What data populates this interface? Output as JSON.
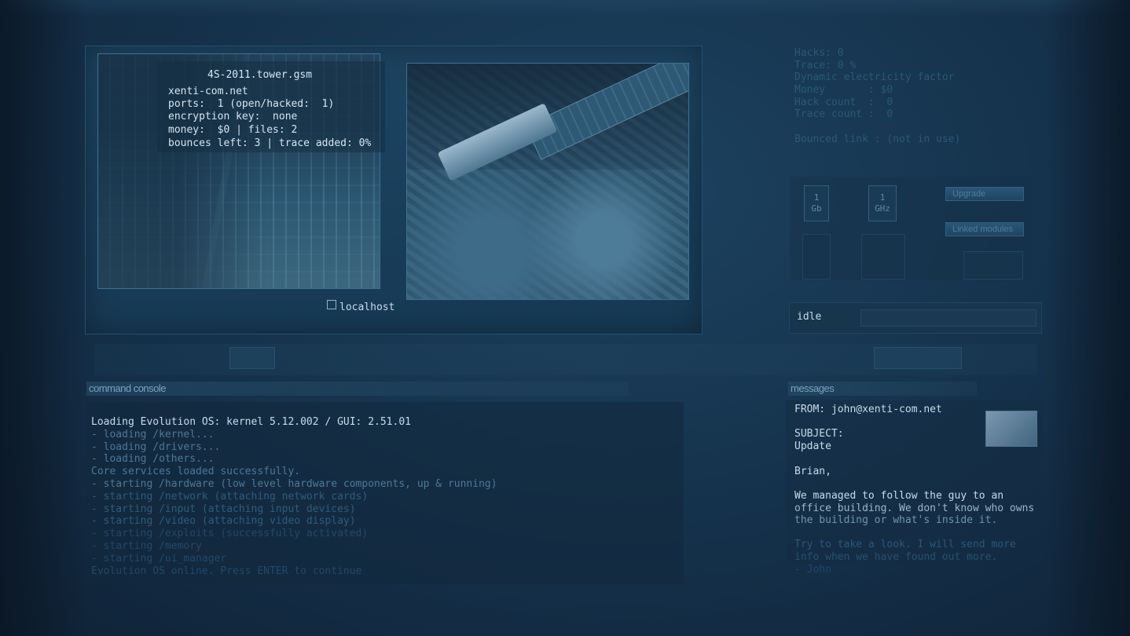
{
  "app": {
    "top_title": "",
    "top_left_label": ""
  },
  "viewport": {
    "host_name": "4S-2011.tower.gsm",
    "domain": "xenti-com.net",
    "ports": "ports:  1 (open/hacked:  1)",
    "encryption": "encryption key:  none",
    "money_files": "money:  $0 | files: 2",
    "bounces": "bounces left: 3 | trace added: 0%",
    "localhost_label": "localhost"
  },
  "stats": {
    "lines": [
      "Hacks: 0",
      "Trace: 0 %",
      "Dynamic electricity factor",
      "Money       : $0",
      "Hack count  :  0",
      "Trace count :  0",
      "",
      "Bounced link : (not in use)"
    ]
  },
  "hardware": {
    "ram_label": "1\nGb",
    "ram_value": "1",
    "ram_unit": "Gb",
    "cpu_value": "1",
    "cpu_unit": "GHz",
    "button_top": "Upgrade",
    "button_bottom": "Linked modules"
  },
  "status": {
    "label": "idle"
  },
  "console": {
    "header": "command console",
    "lines": [
      {
        "text": "Loading Evolution OS: kernel 5.12.002 / GUI: 2.51.01",
        "tone": "bright"
      },
      {
        "text": "- loading /kernel...",
        "tone": "mid"
      },
      {
        "text": "- loading /drivers...",
        "tone": "mid"
      },
      {
        "text": "- loading /others...",
        "tone": "mid"
      },
      {
        "text": "Core services loaded successfully.",
        "tone": "mid"
      },
      {
        "text": "- starting /hardware (low level hardware components, up & running)",
        "tone": "mid"
      },
      {
        "text": "- starting /network (attaching network cards)",
        "tone": "dim"
      },
      {
        "text": "- starting /input (attaching input devices)",
        "tone": "dim"
      },
      {
        "text": "- starting /video (attaching video display)",
        "tone": "dim"
      },
      {
        "text": "- starting /exploits (successfully activated)",
        "tone": "faint"
      },
      {
        "text": "- starting /memory",
        "tone": "faint"
      },
      {
        "text": "- starting /ui_manager",
        "tone": "faint"
      },
      {
        "text": "Evolution OS online. Press ENTER to continue",
        "tone": "faint"
      },
      {
        "text": "",
        "tone": "faint"
      }
    ]
  },
  "messages": {
    "header": "messages",
    "from": "FROM: john@xenti-com.net",
    "subject_label": "SUBJECT:",
    "subject": "Update",
    "greeting": "Brian,",
    "body1": "We managed to follow the guy to an",
    "body2": "office building. We don't know who owns",
    "body3": "the building or what's inside it.",
    "body4": "Try to take a look. I will send more",
    "body5": "info when we have found out more.",
    "body6": "- John"
  },
  "colors": {
    "bright_text": "#c8dcec",
    "mid_text": "#4d7898",
    "dim_text": "#2f5b7c",
    "faint_text": "#23486a"
  }
}
